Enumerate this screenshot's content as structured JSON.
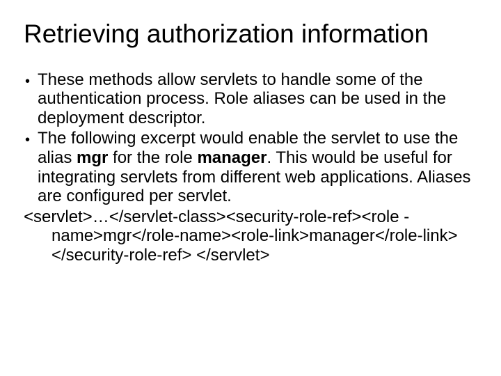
{
  "title": "Retrieving authorization information",
  "bullets": [
    {
      "text": "These methods allow servlets to handle some of the authentication process.  Role aliases can be used in the deployment descriptor."
    },
    {
      "pre": "The following excerpt would enable the servlet to use the alias ",
      "b1": "mgr",
      "mid": " for the role ",
      "b2": "manager",
      "post": ".  This would be useful for integrating servlets from different web applications. Aliases are configured per servlet."
    }
  ],
  "code": "<servlet>…</servlet-class><security-role-ref><role -name>mgr</role-name><role-link>manager</role-link> </security-role-ref> </servlet>"
}
